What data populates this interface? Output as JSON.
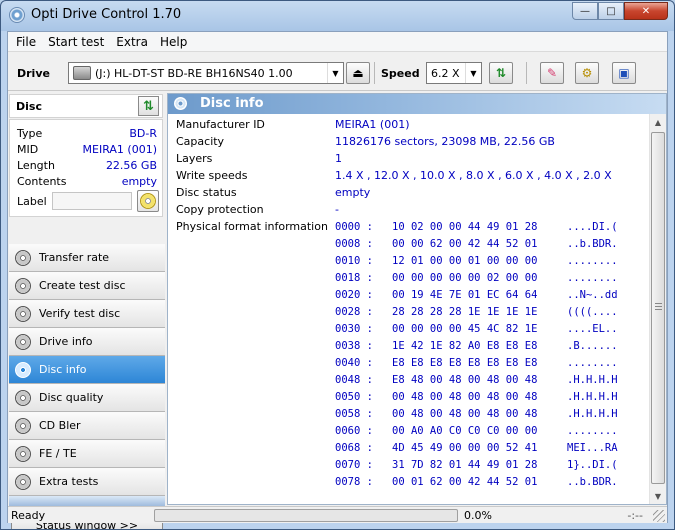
{
  "window": {
    "title": "Opti Drive Control 1.70"
  },
  "menu": [
    "File",
    "Start test",
    "Extra",
    "Help"
  ],
  "toolbar": {
    "drive_label": "Drive",
    "drive_value": "(J:)   HL-DT-ST BD-RE  BH16NS40 1.00",
    "speed_label": "Speed",
    "speed_value": "6.2 X"
  },
  "disc": {
    "header": "Disc",
    "props": [
      {
        "key": "Type",
        "value": "BD-R"
      },
      {
        "key": "MID",
        "value": "MEIRA1 (001)"
      },
      {
        "key": "Length",
        "value": "22.56 GB"
      },
      {
        "key": "Contents",
        "value": "empty"
      }
    ],
    "label_key": "Label",
    "label_value": ""
  },
  "nav": [
    {
      "label": "Transfer rate",
      "active": false
    },
    {
      "label": "Create test disc",
      "active": false
    },
    {
      "label": "Verify test disc",
      "active": false
    },
    {
      "label": "Drive info",
      "active": false
    },
    {
      "label": "Disc info",
      "active": true
    },
    {
      "label": "Disc quality",
      "active": false
    },
    {
      "label": "CD Bler",
      "active": false
    },
    {
      "label": "FE / TE",
      "active": false
    },
    {
      "label": "Extra tests",
      "active": false
    }
  ],
  "status_window_button": "Status window >>",
  "content": {
    "title": "Disc info",
    "info": [
      {
        "key": "Manufacturer ID",
        "value": "MEIRA1 (001)"
      },
      {
        "key": "Capacity",
        "value": "11826176 sectors, 23098 MB, 22.56 GB"
      },
      {
        "key": "Layers",
        "value": "1"
      },
      {
        "key": "Write speeds",
        "value": "1.4 X , 12.0 X , 10.0 X , 8.0 X , 6.0 X , 4.0 X , 2.0 X"
      },
      {
        "key": "Disc status",
        "value": "empty"
      },
      {
        "key": "Copy protection",
        "value": "-"
      },
      {
        "key": "Physical format information",
        "value": ""
      }
    ],
    "hex": [
      {
        "offset": "0000 :",
        "bytes": "10 02 00 00 44 49 01 28",
        "ascii": "....DI.("
      },
      {
        "offset": "0008 :",
        "bytes": "00 00 62 00 42 44 52 01",
        "ascii": "..b.BDR."
      },
      {
        "offset": "0010 :",
        "bytes": "12 01 00 00 01 00 00 00",
        "ascii": "........"
      },
      {
        "offset": "0018 :",
        "bytes": "00 00 00 00 00 02 00 00",
        "ascii": "........"
      },
      {
        "offset": "0020 :",
        "bytes": "00 19 4E 7E 01 EC 64 64",
        "ascii": "..N~..dd"
      },
      {
        "offset": "0028 :",
        "bytes": "28 28 28 28 1E 1E 1E 1E",
        "ascii": "((((...."
      },
      {
        "offset": "0030 :",
        "bytes": "00 00 00 00 45 4C 82 1E",
        "ascii": "....EL.."
      },
      {
        "offset": "0038 :",
        "bytes": "1E 42 1E 82 A0 E8 E8 E8",
        "ascii": ".B......"
      },
      {
        "offset": "0040 :",
        "bytes": "E8 E8 E8 E8 E8 E8 E8 E8",
        "ascii": "........"
      },
      {
        "offset": "0048 :",
        "bytes": "E8 48 00 48 00 48 00 48",
        "ascii": ".H.H.H.H"
      },
      {
        "offset": "0050 :",
        "bytes": "00 48 00 48 00 48 00 48",
        "ascii": ".H.H.H.H"
      },
      {
        "offset": "0058 :",
        "bytes": "00 48 00 48 00 48 00 48",
        "ascii": ".H.H.H.H"
      },
      {
        "offset": "0060 :",
        "bytes": "00 A0 A0 C0 C0 C0 00 00",
        "ascii": "........"
      },
      {
        "offset": "0068 :",
        "bytes": "4D 45 49 00 00 00 52 41",
        "ascii": "MEI...RA"
      },
      {
        "offset": "0070 :",
        "bytes": "31 7D 82 01 44 49 01 28",
        "ascii": "1}..DI.("
      },
      {
        "offset": "0078 :",
        "bytes": "00 01 62 00 42 44 52 01",
        "ascii": "..b.BDR."
      }
    ]
  },
  "status": {
    "text": "Ready",
    "progress_fraction": 0.0,
    "progress_text": "0.0%",
    "time": "-:--"
  },
  "colors": {
    "value_text": "#0000c0",
    "active_nav": "#2d86d6",
    "header_bar": "#6d9acb"
  }
}
